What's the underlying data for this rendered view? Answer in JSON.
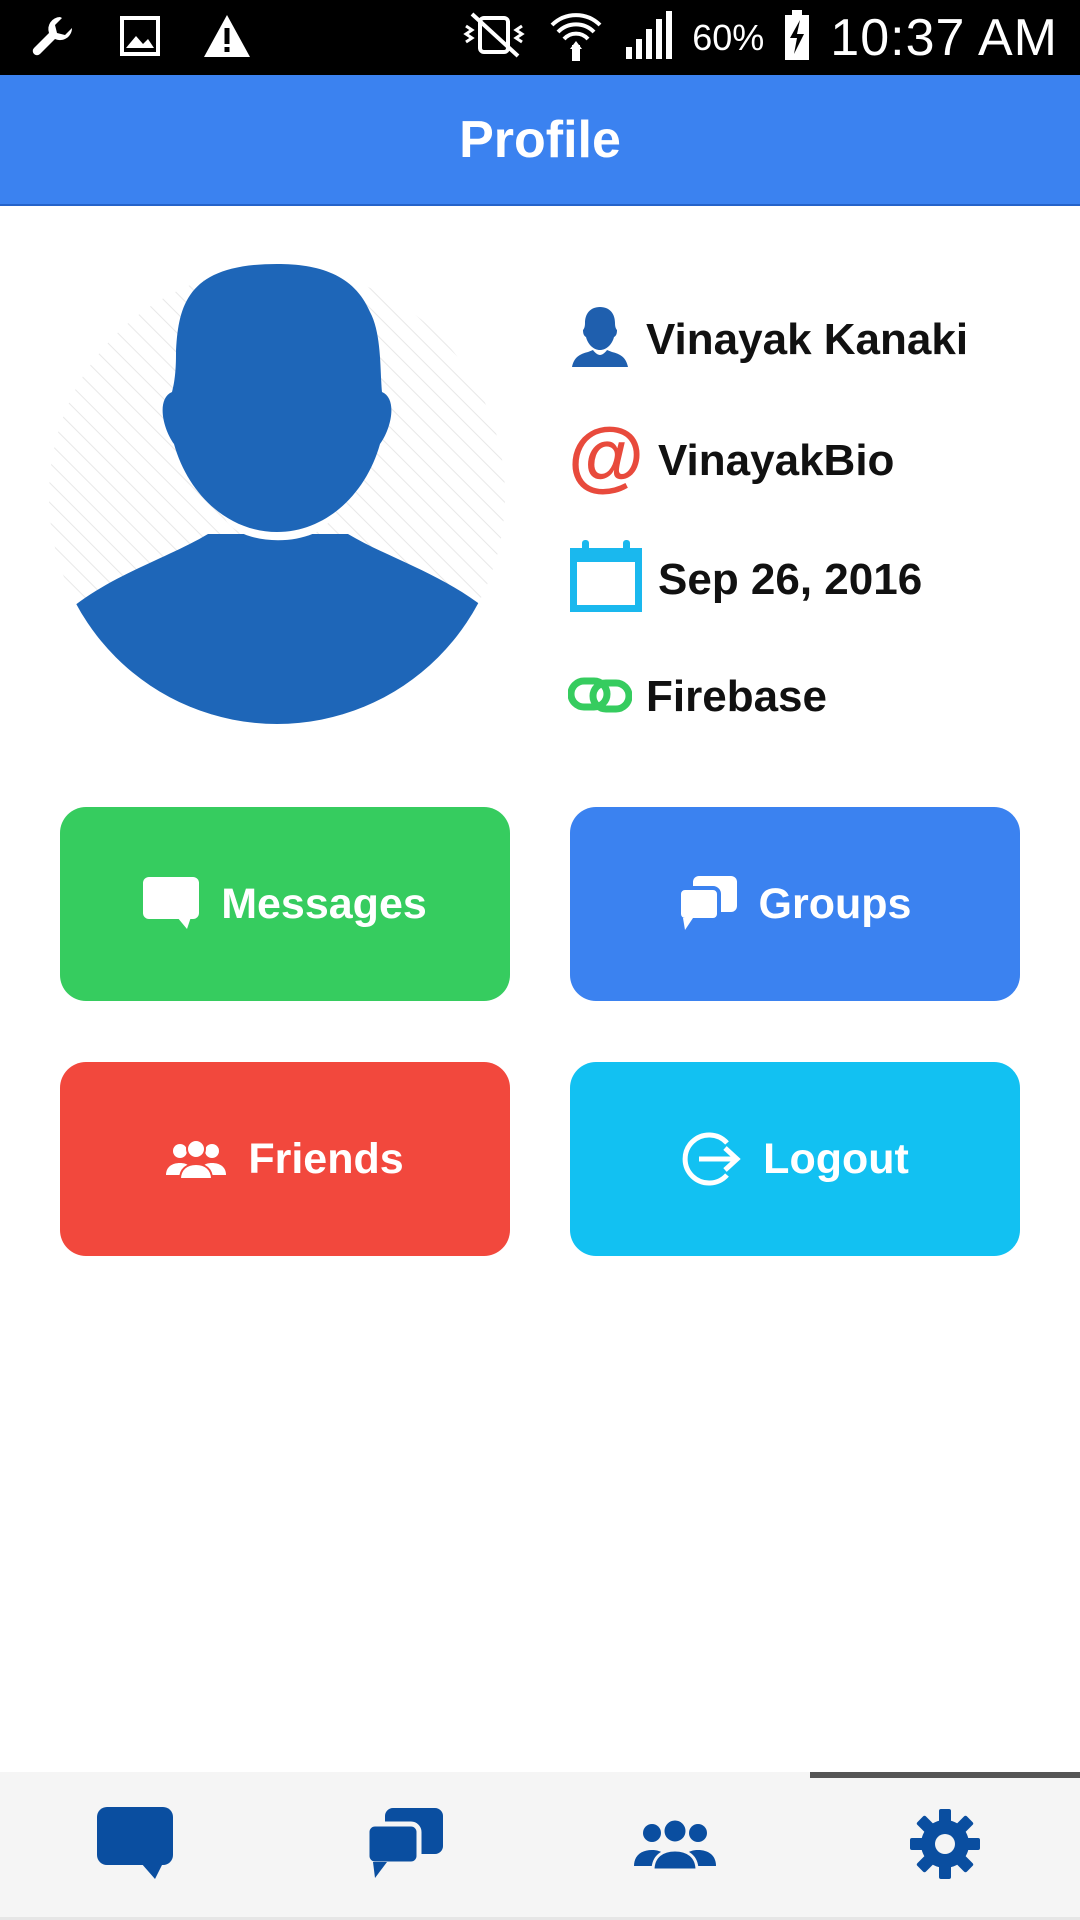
{
  "status_bar": {
    "battery_text": "60%",
    "time": "10:37 AM",
    "left_icons": [
      "wrench-icon",
      "image-icon",
      "warning-icon"
    ],
    "right_icons": [
      "mute-vibrate-icon",
      "wifi-icon",
      "signal-icon",
      "battery-charging-icon"
    ]
  },
  "app_bar": {
    "title": "Profile"
  },
  "profile": {
    "name": "Vinayak Kanaki",
    "username": "VinayakBio",
    "date": "Sep 26, 2016",
    "provider": "Firebase",
    "icon_colors": {
      "name": "#1f5fae",
      "username": "#e84a3c",
      "date": "#1ab8ee",
      "provider": "#36cc5f"
    }
  },
  "buttons": {
    "messages": "Messages",
    "groups": "Groups",
    "friends": "Friends",
    "logout": "Logout"
  },
  "colors": {
    "app_bar": "#3b82f0",
    "messages": "#36cc5f",
    "groups": "#3b82f0",
    "friends": "#f2483d",
    "logout": "#12c1f2",
    "nav_icon": "#0a4ea0"
  },
  "bottom_nav": {
    "items": [
      "chat-icon",
      "chats-icon",
      "friends-icon",
      "settings-icon"
    ],
    "active": "settings-icon"
  }
}
